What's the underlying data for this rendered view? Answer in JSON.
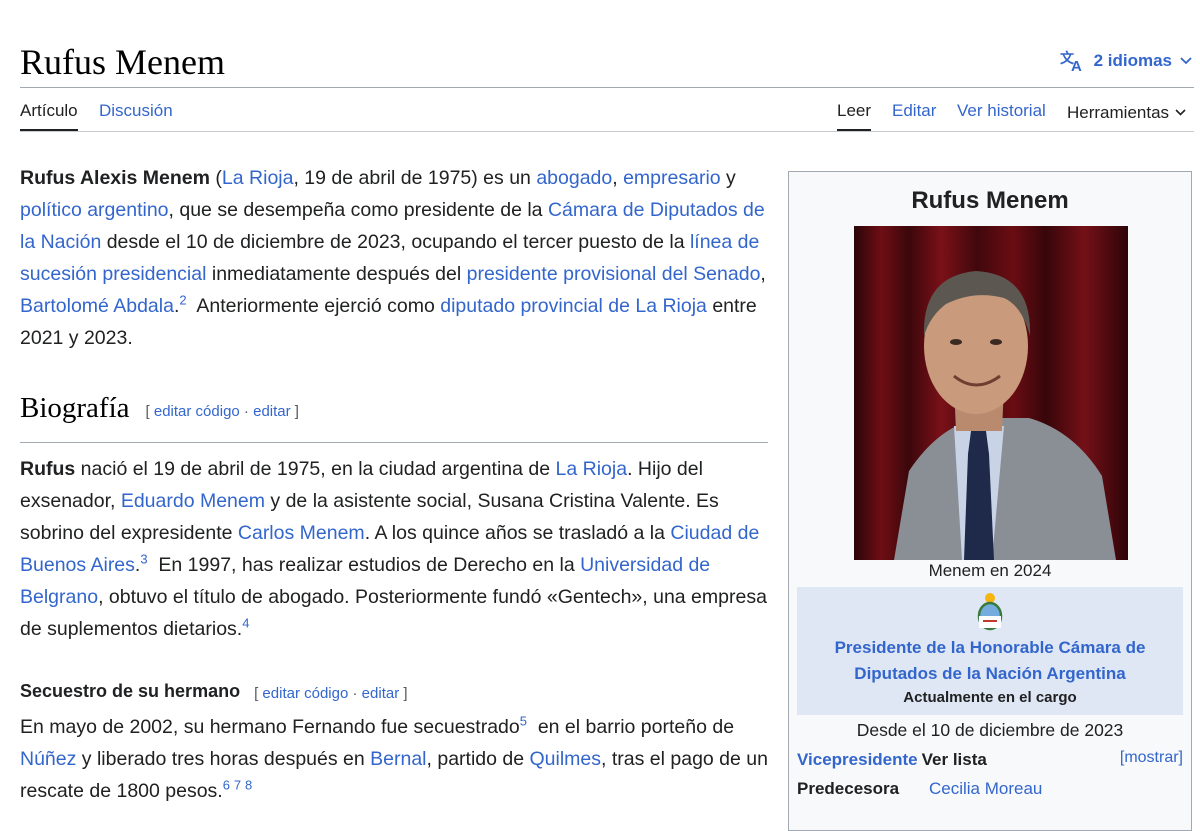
{
  "header": {
    "title": "Rufus Menem",
    "languages_label": "2 idiomas"
  },
  "tabs": {
    "left": [
      "Artículo",
      "Discusión"
    ],
    "right": [
      "Leer",
      "Editar",
      "Ver historial",
      "Herramientas"
    ]
  },
  "intro": {
    "bold_name": "Rufus Alexis Menem",
    "t1": " (",
    "l_rioja": "La Rioja",
    "t2": ", 19 de abril de 1975) es un ",
    "l_abogado": "abogado",
    "t3": ", ",
    "l_empresario": "empresario",
    "t4": " y ",
    "l_politico": "político argentino",
    "t5": ", que se desempeña como presidente de la ",
    "l_camara": "Cámara de Diputados de la Nación",
    "t6": " desde el 10 de diciembre de 2023, ocupando el tercer puesto de la ",
    "l_linea": "línea de sucesión presidencial",
    "t7": " inmediatamente después del ",
    "l_presidente": "presidente provisional del Senado",
    "t8": ", ",
    "l_abdala": "Bartolomé Abdala",
    "t9": ".",
    "ref": "2",
    "t10": "  Anteriormente ejerció como ",
    "l_diputado": "diputado provincial de La Rioja",
    "t11": " entre 2021 y 2023."
  },
  "section": {
    "title": "Biografía",
    "edit_open": "[ ",
    "edit_code": "editar código",
    "edit_sep": " · ",
    "edit": "editar",
    "edit_close": " ]"
  },
  "bio": {
    "bold": "Rufus",
    "t1": " nació el 19 de abril de 1975, en la ciudad argentina de ",
    "l_rioja": "La Rioja",
    "t2": ". Hijo del exsenador, ",
    "l_eduardo": "Eduardo Menem",
    "t3": " y de la asistente social, Susana Cristina Valente. Es sobrino del expresidente ",
    "l_carlos": "Carlos Menem",
    "t4": ". A los quince años se trasladó a la ",
    "l_ciudad": "Ciudad de Buenos Aires",
    "t5": ".",
    "ref3": "3",
    "t6": "  En 1997, has realizar estudios de Derecho en la ",
    "l_univ": "Universidad de Belgrano",
    "t7": ", obtuvo el título de abogado. Posteriormente fundó «Gentech», una empresa de suplementos dietarios.",
    "ref4": "4"
  },
  "subsection": {
    "title": "Secuestro de su hermano"
  },
  "kidnap": {
    "t1": "En mayo de 2002, su hermano Fernando fue secuestrado",
    "ref5": "5",
    "t2": "  en el barrio porteño de ",
    "l_nunez": "Núñez",
    "t3": " y liberado tres horas después en ",
    "l_bernal": "Bernal",
    "t4": ", partido de ",
    "l_quilmes": "Quilmes",
    "t5": ", tras el pago de un rescate de 1800 pesos.",
    "refs": [
      "6",
      "7",
      "8"
    ]
  },
  "infobox": {
    "title": "Rufus Menem",
    "caption": "Menem en 2024",
    "office_title": "Presidente de la Honorable Cámara de Diputados de la Nación Argentina",
    "office_status": "Actualmente en el cargo",
    "since": "Desde el 10 de diciembre de 2023",
    "vp_label": "Vicepresidente",
    "vp_value": "Ver lista",
    "toggle": "[mostrar]",
    "pred_label": "Predecesora",
    "pred_value": "Cecilia Moreau"
  },
  "colors": {
    "link": "#3366cc",
    "office_bg": "#dfe6f4",
    "infobox_bg": "#f8f9fa"
  },
  "icons": [
    "translate-icon",
    "chevron-down-icon",
    "coat-of-arms-icon"
  ]
}
